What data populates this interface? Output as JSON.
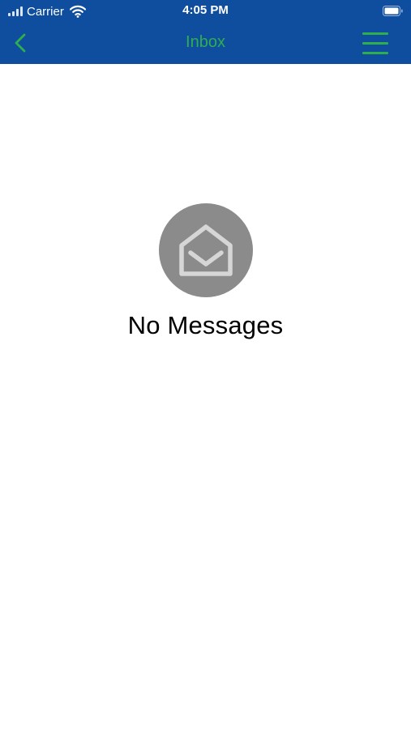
{
  "status_bar": {
    "carrier": "Carrier",
    "time": "4:05 PM",
    "icons": [
      "signal-icon",
      "wifi-icon",
      "battery-icon"
    ]
  },
  "nav_bar": {
    "title": "Inbox",
    "back_icon": "chevron-left-icon",
    "menu_icon": "hamburger-menu-icon"
  },
  "empty_state": {
    "icon": "open-envelope-icon",
    "message": "No Messages"
  },
  "colors": {
    "bar_background": "#0f4d9f",
    "accent_green": "#2fae4e",
    "icon_circle": "#8b8b8b",
    "icon_stroke": "#d6d6d6"
  }
}
